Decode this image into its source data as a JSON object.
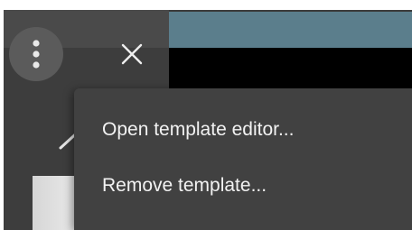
{
  "toolbar": {
    "more_icon": "more-vertical-icon",
    "close_icon": "close-icon"
  },
  "context_menu": {
    "items": [
      {
        "label": "Open template editor..."
      },
      {
        "label": "Remove template..."
      }
    ]
  },
  "colors": {
    "panel_background": "#3d3d3d",
    "menu_background": "#414141",
    "menu_text": "#f2f2f2",
    "preview_accent": "#5b7e8c"
  }
}
